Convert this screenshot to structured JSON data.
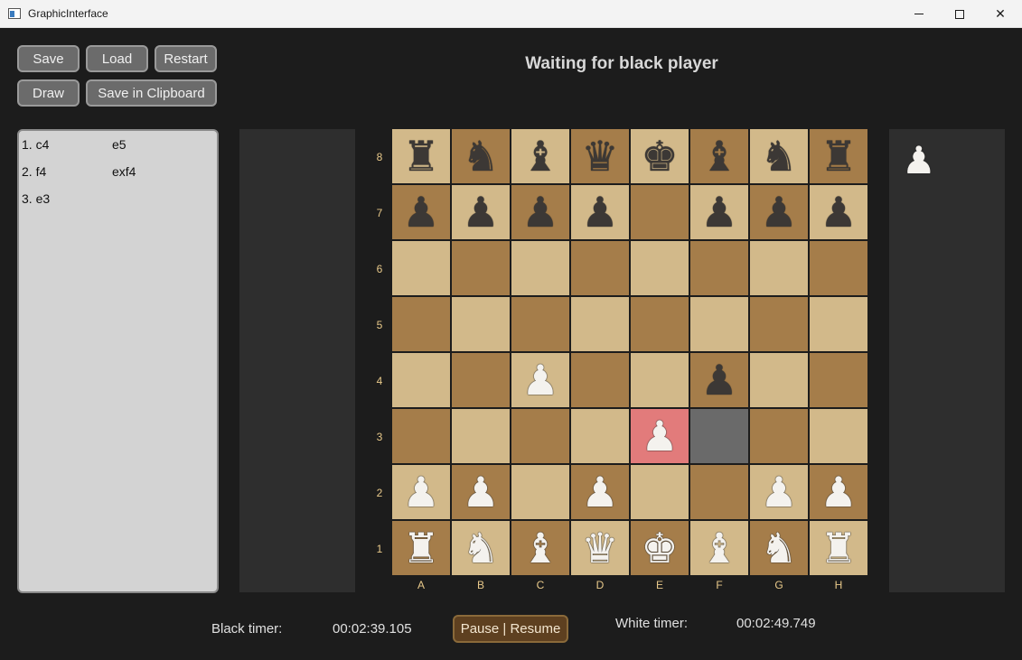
{
  "window": {
    "title": "GraphicInterface"
  },
  "toolbar": {
    "save": "Save",
    "load": "Load",
    "restart": "Restart",
    "draw": "Draw",
    "save_clipboard": "Save in Clipboard"
  },
  "status": "Waiting for black player",
  "moves": [
    {
      "white": "1. c4",
      "black": "e5"
    },
    {
      "white": "2. f4",
      "black": "exf4"
    },
    {
      "white": "3. e3",
      "black": ""
    }
  ],
  "board": {
    "ranks": [
      "8",
      "7",
      "6",
      "5",
      "4",
      "3",
      "2",
      "1"
    ],
    "files": [
      "A",
      "B",
      "C",
      "D",
      "E",
      "F",
      "G",
      "H"
    ],
    "pieces": [
      [
        "br",
        "bn",
        "bb",
        "bq",
        "bk",
        "bb",
        "bn",
        "br"
      ],
      [
        "bp",
        "bp",
        "bp",
        "bp",
        "",
        "bp",
        "bp",
        "bp"
      ],
      [
        "",
        "",
        "",
        "",
        "",
        "",
        "",
        ""
      ],
      [
        "",
        "",
        "",
        "",
        "",
        "",
        "",
        ""
      ],
      [
        "",
        "",
        "wp",
        "",
        "",
        "bp",
        "",
        ""
      ],
      [
        "",
        "",
        "",
        "",
        "wp",
        "",
        "",
        ""
      ],
      [
        "wp",
        "wp",
        "",
        "wp",
        "",
        "",
        "wp",
        "wp"
      ],
      [
        "wr",
        "wn",
        "wb",
        "wq",
        "wk",
        "wb",
        "wn",
        "wr"
      ]
    ],
    "highlight_last_move_to": "E3",
    "highlight_last_move_from": "F3",
    "colors": {
      "light": "#d2b98a",
      "dark": "#a57d4a",
      "last_move": "#e27b7b",
      "from_square": "#6a6a6a"
    }
  },
  "captured_by_black": [
    "wp"
  ],
  "timers": {
    "black_label": "Black timer:",
    "black_value": "00:02:39.105",
    "white_label": "White timer:",
    "white_value": "00:02:49.749",
    "pause_label": "Pause | Resume"
  }
}
